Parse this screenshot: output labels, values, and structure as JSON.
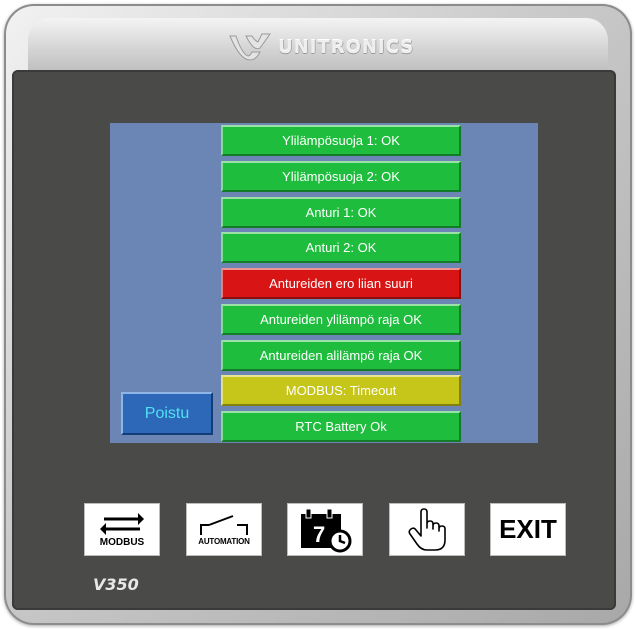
{
  "brand": {
    "name": "UNITRONICS",
    "logo_icon": "unitronics-logo-icon"
  },
  "screen": {
    "status_items": [
      {
        "label": "Ylilämpösuoja 1: OK",
        "state": "ok",
        "color": "#1fbd3e"
      },
      {
        "label": "Ylilämpösuoja 2: OK",
        "state": "ok",
        "color": "#1fbd3e"
      },
      {
        "label": "Anturi 1: OK",
        "state": "ok",
        "color": "#1fbd3e"
      },
      {
        "label": "Anturi 2: OK",
        "state": "ok",
        "color": "#1fbd3e"
      },
      {
        "label": "Antureiden ero liian suuri",
        "state": "alarm",
        "color": "#d81414"
      },
      {
        "label": "Antureiden ylilämpö raja OK",
        "state": "ok",
        "color": "#1fbd3e"
      },
      {
        "label": "Antureiden alilämpö raja OK",
        "state": "ok",
        "color": "#1fbd3e"
      },
      {
        "label": "MODBUS: Timeout",
        "state": "warning",
        "color": "#c6c51a"
      },
      {
        "label": "RTC Battery Ok",
        "state": "ok",
        "color": "#1fbd3e"
      }
    ],
    "exit_button_label": "Poistu",
    "background_color": "#6b86b5"
  },
  "keys": [
    {
      "label": "MODBUS",
      "icon": "modbus-arrows-icon"
    },
    {
      "label": "AUTOMATION",
      "icon": "automation-switch-icon"
    },
    {
      "label": "",
      "icon": "calendar-clock-icon",
      "calendar_day": "7"
    },
    {
      "label": "",
      "icon": "touch-hand-icon"
    },
    {
      "label": "EXIT",
      "icon": "exit-text-icon"
    }
  ],
  "model": "V350"
}
